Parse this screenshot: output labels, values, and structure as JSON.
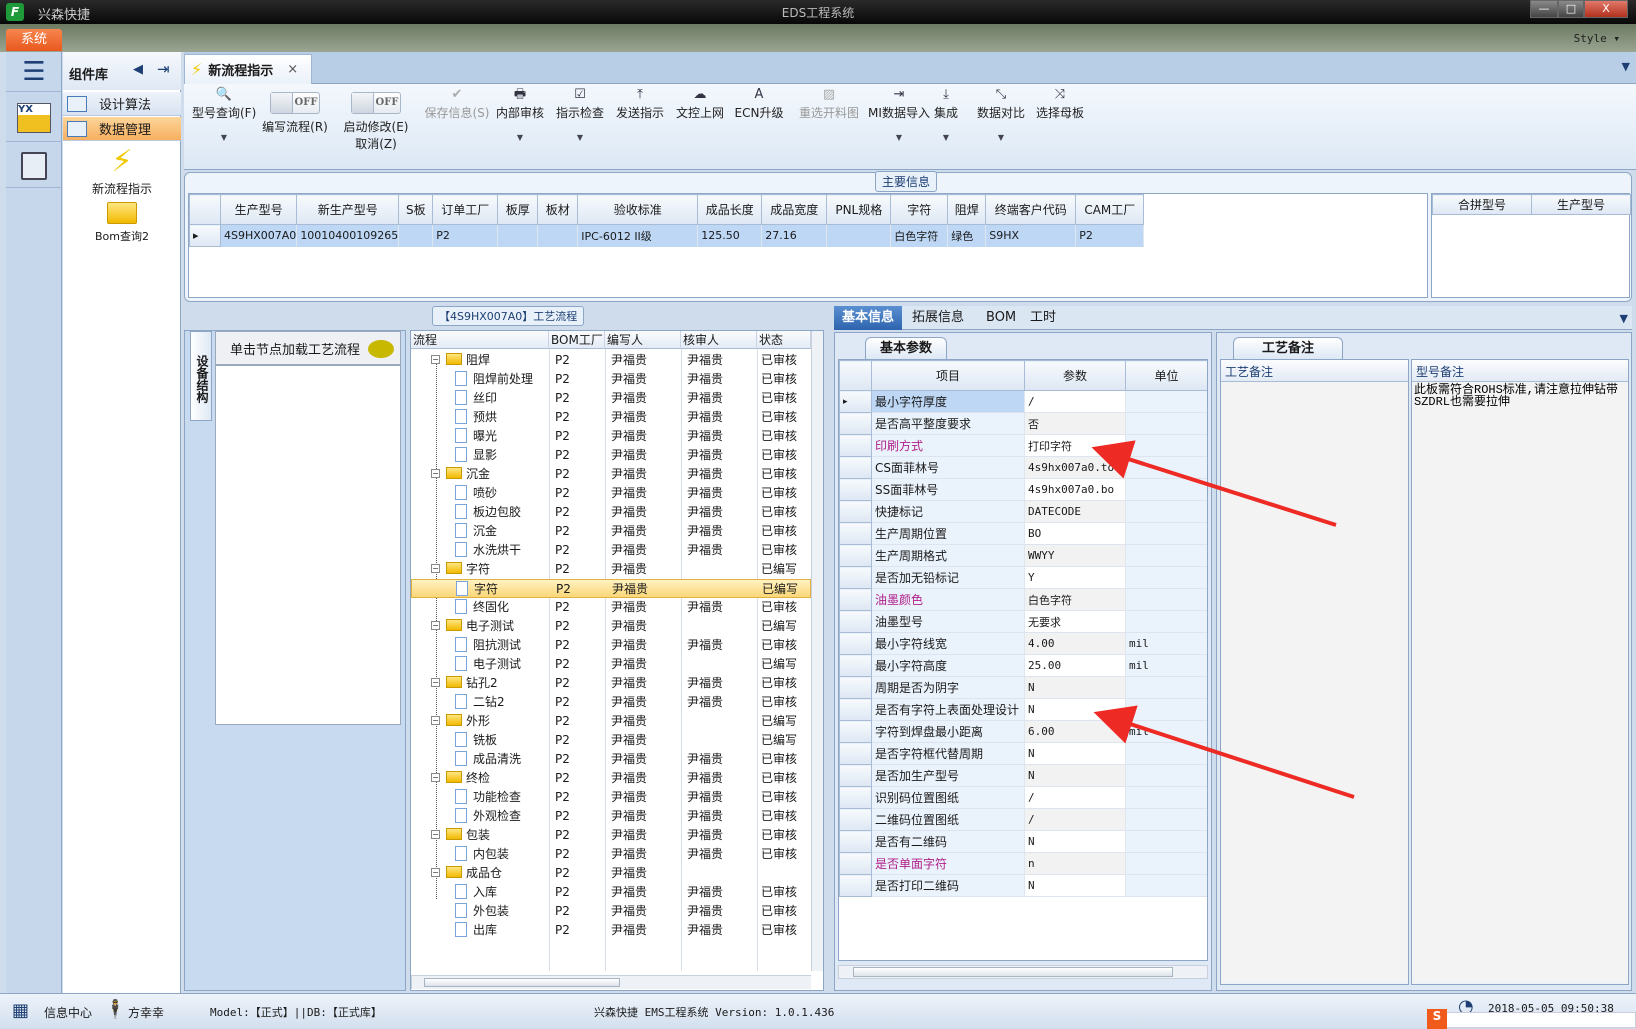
{
  "titlebar": {
    "app_name": "兴森快捷",
    "title": "EDS工程系统",
    "minimize": "—",
    "maximize": "□",
    "close": "X"
  },
  "system_tab": "系统",
  "style_menu": "Style",
  "component_panel": {
    "title": "组件库",
    "items": [
      {
        "label": "设计算法",
        "active": false
      },
      {
        "label": "数据管理",
        "active": true
      }
    ],
    "shortcuts": [
      {
        "label": "新流程指示",
        "icon": "lightning-icon"
      },
      {
        "label": "Bom查询2",
        "icon": "folder-open-icon"
      }
    ]
  },
  "doc_tab": {
    "label": "新流程指示",
    "close": "×"
  },
  "toolbar": {
    "items": [
      {
        "label": "型号查询(F)",
        "icon": "🔍",
        "dropdown": true,
        "enabled": true
      },
      {
        "label": "编写流程(R)",
        "toggle": "OFF",
        "enabled": true
      },
      {
        "label": "启动修改(E)",
        "label2": "取消(Z)",
        "toggle": "OFF",
        "enabled": true
      },
      {
        "label": "保存信息(S)",
        "icon": "✔",
        "enabled": false
      },
      {
        "label": "内部审核",
        "icon": "🖶",
        "dropdown": true,
        "enabled": true
      },
      {
        "label": "指示检查",
        "icon": "☑",
        "dropdown": true,
        "enabled": true
      },
      {
        "label": "发送指示",
        "icon": "⤒",
        "enabled": true
      },
      {
        "label": "文控上网",
        "icon": "☁",
        "enabled": true
      },
      {
        "label": "ECN升级",
        "icon": "A",
        "enabled": true
      },
      {
        "label": "重选开料图",
        "icon": "▨",
        "enabled": false
      },
      {
        "label": "MI数据导入",
        "icon": "⇥",
        "dropdown": true,
        "enabled": true
      },
      {
        "label": "集成",
        "icon": "⤓",
        "dropdown": true,
        "enabled": true
      },
      {
        "label": "数据对比",
        "icon": "⤡",
        "dropdown": true,
        "enabled": true
      },
      {
        "label": "选择母板",
        "icon": "⤨",
        "enabled": true
      }
    ]
  },
  "main_info": {
    "group_label": "主要信息",
    "columns": [
      "生产型号",
      "新生产型号",
      "S板",
      "订单工厂",
      "板厚",
      "板材",
      "验收标准",
      "成品长度",
      "成品宽度",
      "PNL规格",
      "字符",
      "阻焊",
      "终端客户代码",
      "CAM工厂"
    ],
    "rows": [
      [
        "4S9HX007A0",
        "10010400109265",
        "",
        "P2",
        "",
        "",
        "IPC-6012 II级",
        "125.50",
        "27.16",
        "",
        "白色字符",
        "绿色",
        "S9HX",
        "P2"
      ]
    ],
    "merge_columns": [
      "合拼型号",
      "生产型号"
    ]
  },
  "left_panel": {
    "vertical_tab": "设备结构",
    "hint": "单击节点加载工艺流程"
  },
  "process": {
    "group_label": "【4S9HX007A0】工艺流程",
    "columns": [
      "流程",
      "BOM工厂",
      "编写人",
      "核审人",
      "状态"
    ],
    "rows": [
      {
        "name": "阻焊",
        "folder": true,
        "factory": "P2",
        "writer": "尹福贵",
        "reviewer": "尹福贵",
        "status": "已审核"
      },
      {
        "name": "阻焊前处理",
        "factory": "P2",
        "writer": "尹福贵",
        "reviewer": "尹福贵",
        "status": "已审核"
      },
      {
        "name": "丝印",
        "factory": "P2",
        "writer": "尹福贵",
        "reviewer": "尹福贵",
        "status": "已审核"
      },
      {
        "name": "预烘",
        "factory": "P2",
        "writer": "尹福贵",
        "reviewer": "尹福贵",
        "status": "已审核"
      },
      {
        "name": "曝光",
        "factory": "P2",
        "writer": "尹福贵",
        "reviewer": "尹福贵",
        "status": "已审核"
      },
      {
        "name": "显影",
        "factory": "P2",
        "writer": "尹福贵",
        "reviewer": "尹福贵",
        "status": "已审核"
      },
      {
        "name": "沉金",
        "folder": true,
        "factory": "P2",
        "writer": "尹福贵",
        "reviewer": "尹福贵",
        "status": "已审核"
      },
      {
        "name": "喷砂",
        "factory": "P2",
        "writer": "尹福贵",
        "reviewer": "尹福贵",
        "status": "已审核"
      },
      {
        "name": "板边包胶",
        "factory": "P2",
        "writer": "尹福贵",
        "reviewer": "尹福贵",
        "status": "已审核"
      },
      {
        "name": "沉金",
        "factory": "P2",
        "writer": "尹福贵",
        "reviewer": "尹福贵",
        "status": "已审核"
      },
      {
        "name": "水洗烘干",
        "factory": "P2",
        "writer": "尹福贵",
        "reviewer": "尹福贵",
        "status": "已审核"
      },
      {
        "name": "字符",
        "folder": true,
        "factory": "P2",
        "writer": "尹福贵",
        "reviewer": "",
        "status": "已编写"
      },
      {
        "name": "字符",
        "factory": "P2",
        "writer": "尹福贵",
        "reviewer": "",
        "status": "已编写",
        "selected": true
      },
      {
        "name": "终固化",
        "factory": "P2",
        "writer": "尹福贵",
        "reviewer": "尹福贵",
        "status": "已审核"
      },
      {
        "name": "电子测试",
        "folder": true,
        "factory": "P2",
        "writer": "尹福贵",
        "reviewer": "",
        "status": "已编写"
      },
      {
        "name": "阻抗测试",
        "factory": "P2",
        "writer": "尹福贵",
        "reviewer": "尹福贵",
        "status": "已审核"
      },
      {
        "name": "电子测试",
        "factory": "P2",
        "writer": "尹福贵",
        "reviewer": "",
        "status": "已编写"
      },
      {
        "name": "钻孔2",
        "folder": true,
        "factory": "P2",
        "writer": "尹福贵",
        "reviewer": "尹福贵",
        "status": "已审核"
      },
      {
        "name": "二钻2",
        "factory": "P2",
        "writer": "尹福贵",
        "reviewer": "尹福贵",
        "status": "已审核"
      },
      {
        "name": "外形",
        "folder": true,
        "factory": "P2",
        "writer": "尹福贵",
        "reviewer": "",
        "status": "已编写"
      },
      {
        "name": "铣板",
        "factory": "P2",
        "writer": "尹福贵",
        "reviewer": "",
        "status": "已编写"
      },
      {
        "name": "成品清洗",
        "factory": "P2",
        "writer": "尹福贵",
        "reviewer": "尹福贵",
        "status": "已审核"
      },
      {
        "name": "终检",
        "folder": true,
        "factory": "P2",
        "writer": "尹福贵",
        "reviewer": "尹福贵",
        "status": "已审核"
      },
      {
        "name": "功能检查",
        "factory": "P2",
        "writer": "尹福贵",
        "reviewer": "尹福贵",
        "status": "已审核"
      },
      {
        "name": "外观检查",
        "factory": "P2",
        "writer": "尹福贵",
        "reviewer": "尹福贵",
        "status": "已审核"
      },
      {
        "name": "包装",
        "folder": true,
        "factory": "P2",
        "writer": "尹福贵",
        "reviewer": "尹福贵",
        "status": "已审核"
      },
      {
        "name": "内包装",
        "factory": "P2",
        "writer": "尹福贵",
        "reviewer": "尹福贵",
        "status": "已审核"
      },
      {
        "name": "成品仓",
        "folder": true,
        "factory": "P2",
        "writer": "尹福贵",
        "reviewer": "",
        "status": ""
      },
      {
        "name": "入库",
        "factory": "P2",
        "writer": "尹福贵",
        "reviewer": "尹福贵",
        "status": "已审核"
      },
      {
        "name": "外包装",
        "factory": "P2",
        "writer": "尹福贵",
        "reviewer": "尹福贵",
        "status": "已审核"
      },
      {
        "name": "出库",
        "factory": "P2",
        "writer": "尹福贵",
        "reviewer": "尹福贵",
        "status": "已审核"
      }
    ]
  },
  "right_tabs": [
    {
      "label": "基本信息",
      "active": true
    },
    {
      "label": "拓展信息"
    },
    {
      "label": "BOM"
    },
    {
      "label": "工时"
    }
  ],
  "params": {
    "subtab": "基本参数",
    "columns": [
      "项目",
      "参数",
      "单位"
    ],
    "rows": [
      {
        "item": "最小字符厚度",
        "value": "/",
        "unit": ""
      },
      {
        "item": "是否高平整度要求",
        "value": "否",
        "unit": ""
      },
      {
        "item": "印刷方式",
        "value": "打印字符",
        "unit": "",
        "highlight": true
      },
      {
        "item": "CS面菲林号",
        "value": "4s9hx007a0.to",
        "unit": ""
      },
      {
        "item": "SS面菲林号",
        "value": "4s9hx007a0.bo",
        "unit": ""
      },
      {
        "item": "快捷标记",
        "value": "DATECODE",
        "unit": ""
      },
      {
        "item": "生产周期位置",
        "value": "BO",
        "unit": ""
      },
      {
        "item": "生产周期格式",
        "value": "WWYY",
        "unit": ""
      },
      {
        "item": "是否加无铅标记",
        "value": "Y",
        "unit": ""
      },
      {
        "item": "油墨颜色",
        "value": "白色字符",
        "unit": "",
        "highlight": true
      },
      {
        "item": "油墨型号",
        "value": "无要求",
        "unit": ""
      },
      {
        "item": "最小字符线宽",
        "value": "4.00",
        "unit": "mil"
      },
      {
        "item": "最小字符高度",
        "value": "25.00",
        "unit": "mil"
      },
      {
        "item": "周期是否为阴字",
        "value": "N",
        "unit": ""
      },
      {
        "item": "是否有字符上表面处理设计",
        "value": "N",
        "unit": ""
      },
      {
        "item": "字符到焊盘最小距离",
        "value": "6.00",
        "unit": "mil"
      },
      {
        "item": "是否字符框代替周期",
        "value": "N",
        "unit": ""
      },
      {
        "item": "是否加生产型号",
        "value": "N",
        "unit": ""
      },
      {
        "item": "识别码位置图纸",
        "value": "/",
        "unit": ""
      },
      {
        "item": "二维码位置图纸",
        "value": "/",
        "unit": ""
      },
      {
        "item": "是否有二维码",
        "value": "N",
        "unit": ""
      },
      {
        "item": "是否单面字符",
        "value": "n",
        "unit": "",
        "highlight": true
      },
      {
        "item": "是否打印二维码",
        "value": "N",
        "unit": ""
      }
    ]
  },
  "notes": {
    "subtab": "工艺备注",
    "process_note_label": "工艺备注",
    "model_note_label": "型号备注",
    "process_note": "",
    "model_note": "此板需符合ROHS标准,请注意拉伸钻带SZDRL也需要拉伸"
  },
  "statusbar": {
    "info_center": "信息中心",
    "user": "方幸幸",
    "model_db": "Model:【正式】||DB:【正式库】",
    "version": "兴森快捷 EMS工程系统 Version: 1.0.1.436",
    "datetime": "2018-05-05 09:50:38"
  },
  "colors": {
    "accent": "#2d64ae",
    "highlight_text": "#b0208a",
    "selected_row": "#bdd7f5",
    "tree_selected": "#fbd778",
    "annotation_arrow": "#ee2a24",
    "system_tab": "#e8581e"
  }
}
